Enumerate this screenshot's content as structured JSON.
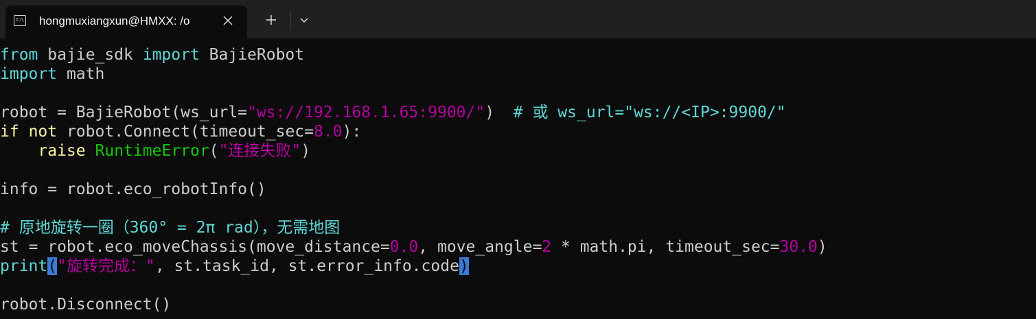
{
  "window": {
    "tab_title": "hongmuxiangxun@HMXX: /o",
    "tab_icon": "terminal-icon",
    "icon_text": "C:\\"
  },
  "terminal": {
    "lines": [
      [
        {
          "t": "from",
          "c": "kw"
        },
        {
          "t": " bajie_sdk "
        },
        {
          "t": "import",
          "c": "kw"
        },
        {
          "t": " BajieRobot"
        }
      ],
      [
        {
          "t": "import",
          "c": "kw"
        },
        {
          "t": " math"
        }
      ],
      [],
      [
        {
          "t": "robot = BajieRobot(ws_url="
        },
        {
          "t": "\"ws://192.168.1.65:9900/\"",
          "c": "str"
        },
        {
          "t": ")  "
        },
        {
          "t": "# 或 ws_url=\"ws://<IP>:9900/\"",
          "c": "cmt"
        }
      ],
      [
        {
          "t": "if",
          "c": "yl"
        },
        {
          "t": " "
        },
        {
          "t": "not",
          "c": "yl"
        },
        {
          "t": " robot.Connect(timeout_sec="
        },
        {
          "t": "8.0",
          "c": "num"
        },
        {
          "t": "):"
        }
      ],
      [
        {
          "t": "    "
        },
        {
          "t": "raise",
          "c": "yl"
        },
        {
          "t": " "
        },
        {
          "t": "RuntimeError",
          "c": "gr"
        },
        {
          "t": "("
        },
        {
          "t": "\"连接失败\"",
          "c": "str"
        },
        {
          "t": ")"
        }
      ],
      [],
      [
        {
          "t": "info = robot.eco_robotInfo()"
        }
      ],
      [],
      [
        {
          "t": "# 原地旋转一圈（360° = 2π rad），无需地图",
          "c": "cmt"
        }
      ],
      [
        {
          "t": "st = robot.eco_moveChassis(move_distance="
        },
        {
          "t": "0.0",
          "c": "num"
        },
        {
          "t": ", move_angle="
        },
        {
          "t": "2",
          "c": "num"
        },
        {
          "t": " * math.pi, timeout_sec="
        },
        {
          "t": "30.0",
          "c": "num"
        },
        {
          "t": ")"
        }
      ],
      [
        {
          "t": "print",
          "c": "kw"
        },
        {
          "t": "(",
          "c": "sel"
        },
        {
          "t": "\"旋转完成：\"",
          "c": "str"
        },
        {
          "t": ", st.task_id, st.error_info.code"
        },
        {
          "t": ")",
          "c": "sel"
        }
      ],
      [],
      [
        {
          "t": "robot.Disconnect()"
        }
      ]
    ]
  }
}
